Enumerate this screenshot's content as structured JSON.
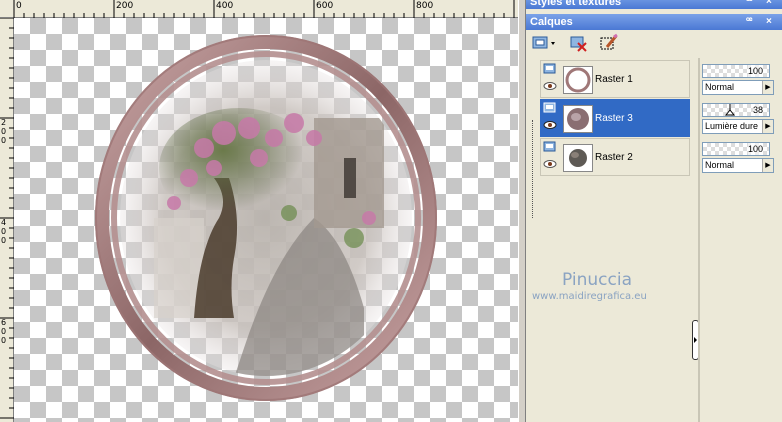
{
  "panels": {
    "styles_title": "Styles et textures",
    "layers_title": "Calques",
    "title_buttons": [
      "ꟹ",
      "×"
    ]
  },
  "ruler": {
    "top_labels": [
      "0",
      "200",
      "400",
      "600",
      "800"
    ],
    "left_labels": [
      "2\n0\n0",
      "4\n0\n0",
      "6\n0\n0"
    ]
  },
  "layers": [
    {
      "name": "Raster 1",
      "opacity": "100",
      "blend": "Normal",
      "selected": false
    },
    {
      "name": "Raster 3",
      "opacity": "38",
      "blend": "Lumière dure",
      "selected": true
    },
    {
      "name": "Raster 2",
      "opacity": "100",
      "blend": "Normal",
      "selected": false
    }
  ],
  "watermark": {
    "name": "Pinuccia",
    "url": "www.maidiregrafica.eu"
  },
  "colors": {
    "selection": "#316ac5",
    "frame": "#a88585",
    "title_gradient": "#4a78d4"
  }
}
